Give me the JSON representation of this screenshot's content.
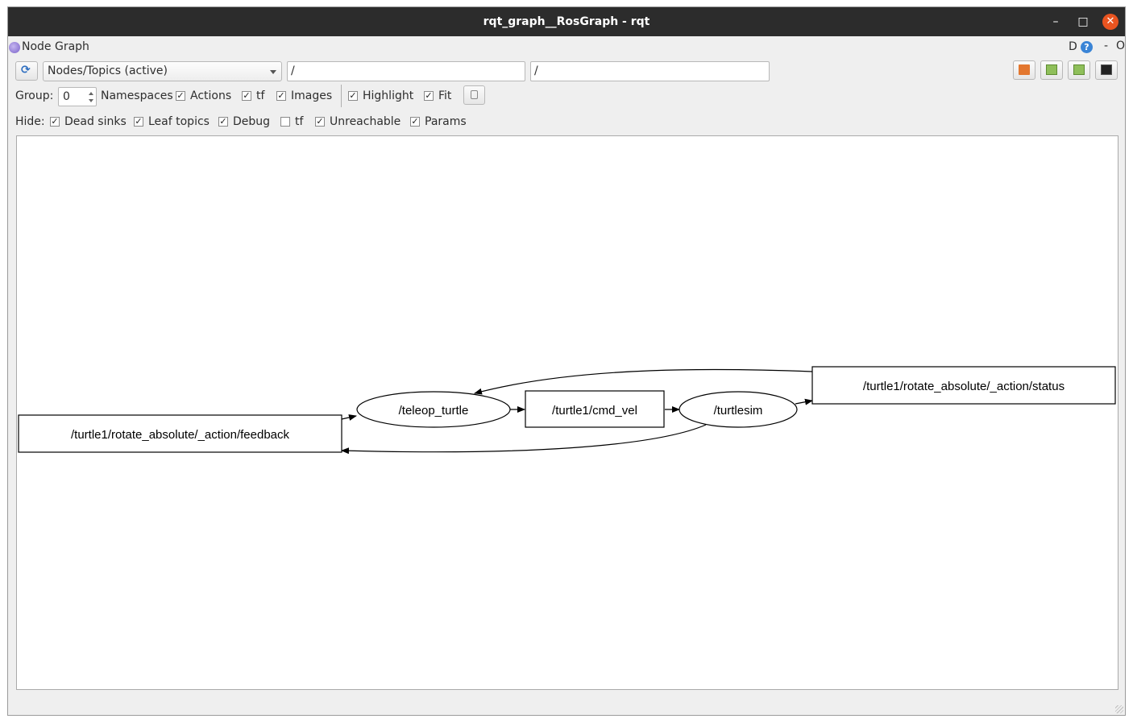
{
  "window": {
    "title": "rqt_graph__RosGraph - rqt",
    "controls": {
      "minimize": "–",
      "maximize": "□",
      "close": "✕"
    }
  },
  "plugin": {
    "title": "Node Graph",
    "dock_d": "D",
    "dock_help": "?",
    "dock_minimize": "-",
    "dock_close": "O"
  },
  "toolbar": {
    "graph_mode": "Nodes/Topics (active)",
    "filter_ns": "/",
    "filter_topic": "/",
    "icons": [
      "refresh-icon",
      "open-file-icon",
      "save-dot-icon",
      "save-image-icon",
      "screenshot-icon"
    ]
  },
  "options": {
    "group_label": "Group:",
    "group_value": "0",
    "namespaces_label": "Namespaces",
    "actions": {
      "label": "Actions",
      "checked": true
    },
    "tf": {
      "label": "tf",
      "checked": true
    },
    "images": {
      "label": "Images",
      "checked": true
    },
    "highlight": {
      "label": "Highlight",
      "checked": true
    },
    "fit": {
      "label": "Fit",
      "checked": true
    }
  },
  "hide": {
    "label": "Hide:",
    "dead_sinks": {
      "label": "Dead sinks",
      "checked": true
    },
    "leaf_topics": {
      "label": "Leaf topics",
      "checked": true
    },
    "debug": {
      "label": "Debug",
      "checked": true
    },
    "tf": {
      "label": "tf",
      "checked": false
    },
    "unreachable": {
      "label": "Unreachable",
      "checked": true
    },
    "params": {
      "label": "Params",
      "checked": true
    }
  },
  "graph": {
    "nodes": {
      "feedback": "/turtle1/rotate_absolute/_action/feedback",
      "teleop": "/teleop_turtle",
      "cmd_vel": "/turtle1/cmd_vel",
      "turtlesim": "/turtlesim",
      "status": "/turtle1/rotate_absolute/_action/status"
    },
    "edges": [
      [
        "feedback",
        "teleop"
      ],
      [
        "teleop",
        "cmd_vel"
      ],
      [
        "cmd_vel",
        "turtlesim"
      ],
      [
        "turtlesim",
        "status"
      ],
      [
        "status",
        "teleop"
      ],
      [
        "turtlesim",
        "feedback"
      ]
    ]
  }
}
